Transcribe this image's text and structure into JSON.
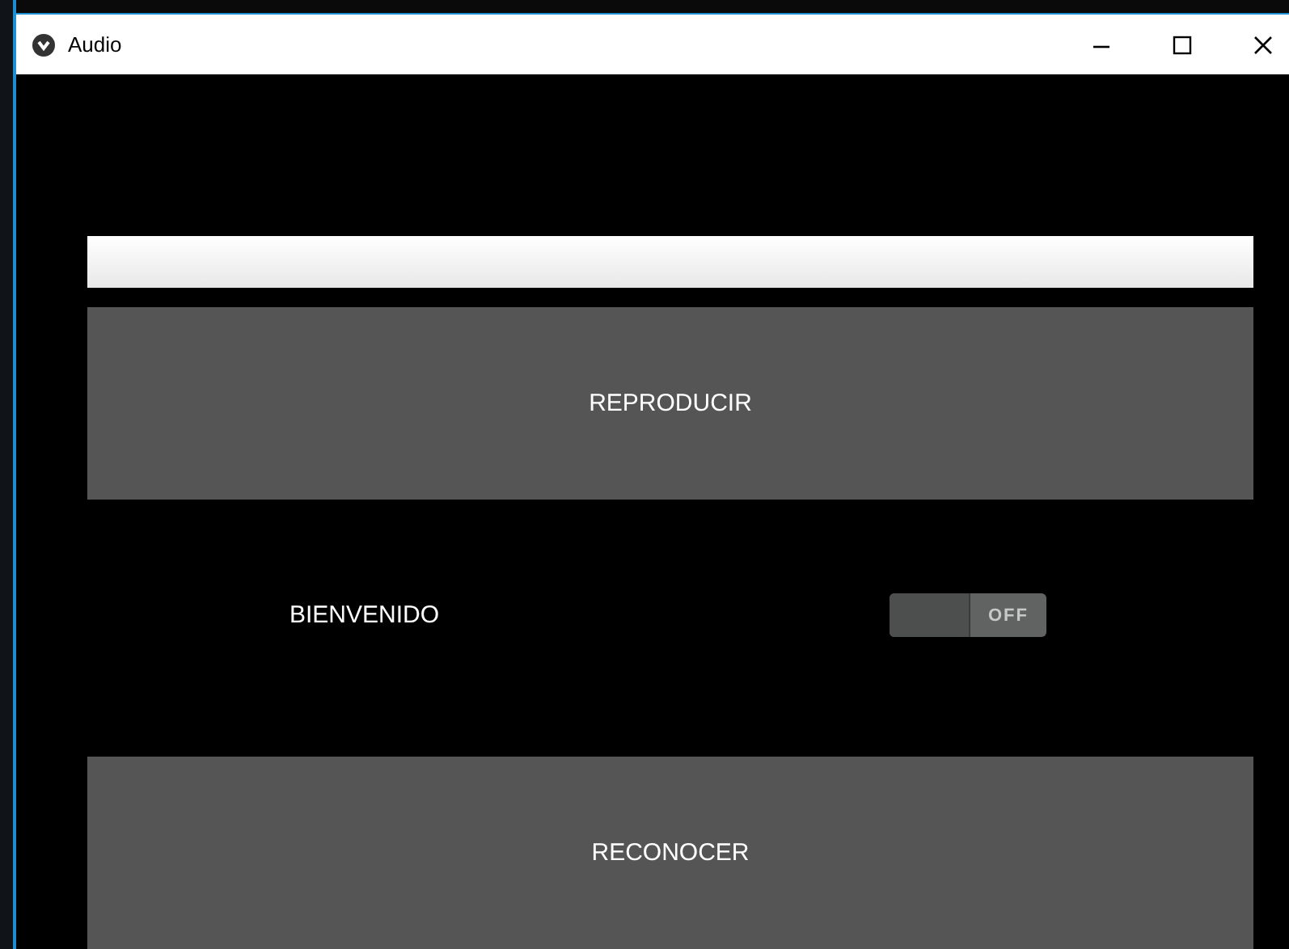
{
  "window": {
    "title": "Audio"
  },
  "play_button": {
    "label": "REPRODUCIR"
  },
  "welcome": {
    "label": "BIENVENIDO"
  },
  "toggle": {
    "label": "OFF",
    "on": false
  },
  "recognize_button": {
    "label": "RECONOCER"
  }
}
